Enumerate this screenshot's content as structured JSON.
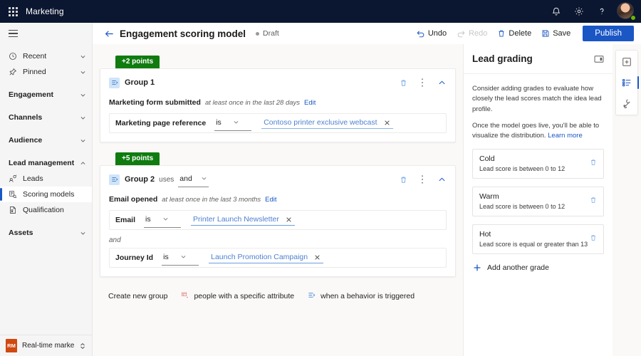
{
  "topnav": {
    "waffle_label": "app-launcher",
    "app_title": "Marketing",
    "icons": [
      "notification-bell-icon",
      "gear-icon",
      "help-question-icon",
      "user-avatar"
    ]
  },
  "commandbar": {
    "back_label": "back-arrow",
    "page_title": "Engagement scoring model",
    "status": "Draft",
    "undo_label": "Undo",
    "redo_label": "Redo",
    "delete_label": "Delete",
    "save_label": "Save",
    "publish_label": "Publish"
  },
  "sidebar": {
    "items": [
      {
        "label": "Recent",
        "icon": "clock-icon",
        "chevron": "down",
        "type": "item"
      },
      {
        "label": "Pinned",
        "icon": "pin-icon",
        "chevron": "down",
        "type": "item"
      },
      {
        "label": "Engagement",
        "icon": "",
        "chevron": "down",
        "type": "group"
      },
      {
        "label": "Channels",
        "icon": "",
        "chevron": "down",
        "type": "group"
      },
      {
        "label": "Audience",
        "icon": "",
        "chevron": "down",
        "type": "group"
      },
      {
        "label": "Lead management",
        "icon": "",
        "chevron": "up",
        "type": "group"
      },
      {
        "label": "Leads",
        "icon": "leads-icon",
        "chevron": "",
        "type": "item"
      },
      {
        "label": "Scoring models",
        "icon": "scoring-model-icon",
        "chevron": "",
        "type": "item",
        "selected": true
      },
      {
        "label": "Qualification",
        "icon": "qualification-icon",
        "chevron": "",
        "type": "item"
      },
      {
        "label": "Assets",
        "icon": "",
        "chevron": "down",
        "type": "group"
      }
    ],
    "environment": {
      "badge": "RM",
      "name": "Real-time marketi...",
      "caret": "switcher-caret-icon"
    }
  },
  "builder": {
    "groups": [
      {
        "points_badge": "+2 points",
        "name": "Group 1",
        "uses_label": "",
        "logic_operator": "",
        "trigger": {
          "name": "Marketing form submitted",
          "frequency": "at least once in the last 28 days",
          "edit_label": "Edit"
        },
        "conditions": [
          {
            "attribute": "Marketing page reference",
            "operator": "is",
            "value": "Contoso printer exclusive webcast",
            "joiner": ""
          }
        ]
      },
      {
        "points_badge": "+5 points",
        "name": "Group 2",
        "uses_label": "uses",
        "logic_operator": "and",
        "trigger": {
          "name": "Email opened",
          "frequency": "at least once in the last 3 months",
          "edit_label": "Edit"
        },
        "conditions": [
          {
            "attribute": "Email",
            "operator": "is",
            "value": "Printer Launch Newsletter",
            "joiner": ""
          },
          {
            "attribute": "Journey Id",
            "operator": "is",
            "value": "Launch Promotion Campaign",
            "joiner": "and"
          }
        ]
      }
    ],
    "create_row": {
      "label": "Create new group",
      "option_attribute": "people with a specific attribute",
      "option_behavior": "when a behavior is triggered"
    }
  },
  "right_panel": {
    "title": "Lead grading",
    "collapse_icon": "collapse-panel-icon",
    "paragraph_1": "Consider adding grades to evaluate how closely the lead scores match the idea lead profile.",
    "paragraph_2_text": "Once the model goes live, you'll be able to visualize the distribution. ",
    "paragraph_2_link": "Learn more",
    "grades": [
      {
        "name": "Cold",
        "description": "Lead score is between 0 to 12"
      },
      {
        "name": "Warm",
        "description": "Lead score is between 0 to 12"
      },
      {
        "name": "Hot",
        "description": "Lead score is equal or greater than 13"
      }
    ],
    "add_grade_label": "Add another grade"
  },
  "rail": {
    "buttons": [
      {
        "icon": "add-panel-icon",
        "active": false
      },
      {
        "icon": "list-properties-icon",
        "active": true
      },
      {
        "icon": "settings-tools-icon",
        "active": false
      }
    ]
  },
  "colors": {
    "nav_bar": "#0b1630",
    "accent_blue": "#1a56c4",
    "points_green": "#107c10",
    "link_blue": "#4f81d0",
    "canvas_bg": "#faf9f8",
    "env_badge": "#d0490f"
  }
}
